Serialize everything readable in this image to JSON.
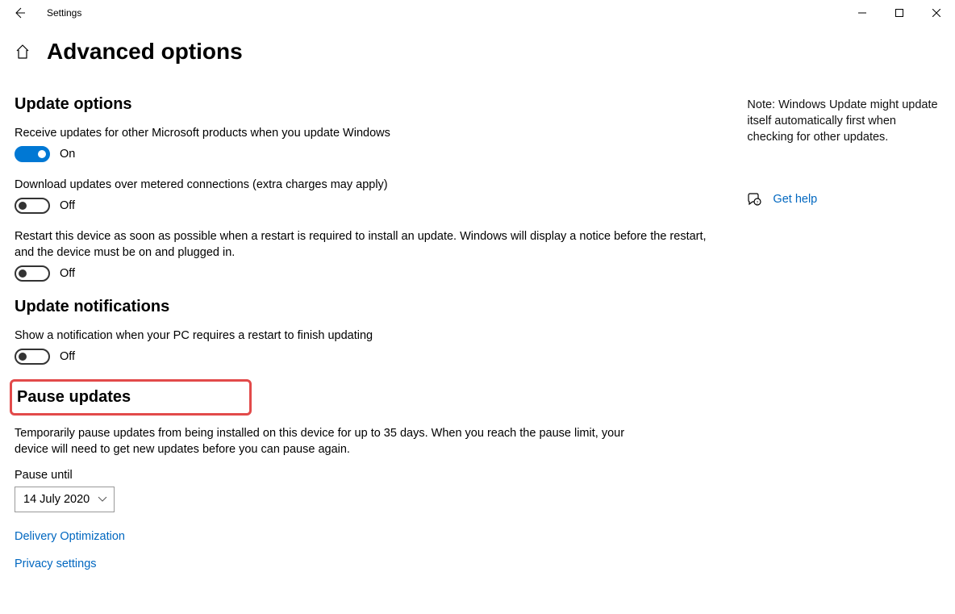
{
  "titlebar": {
    "app_name": "Settings"
  },
  "header": {
    "page_title": "Advanced options"
  },
  "sections": {
    "update_options": {
      "heading": "Update options",
      "opt1_label": "Receive updates for other Microsoft products when you update Windows",
      "opt1_state": "On",
      "opt2_label": "Download updates over metered connections (extra charges may apply)",
      "opt2_state": "Off",
      "opt3_label": "Restart this device as soon as possible when a restart is required to install an update. Windows will display a notice before the restart, and the device must be on and plugged in.",
      "opt3_state": "Off"
    },
    "update_notifications": {
      "heading": "Update notifications",
      "opt1_label": "Show a notification when your PC requires a restart to finish updating",
      "opt1_state": "Off"
    },
    "pause_updates": {
      "heading": "Pause updates",
      "description": "Temporarily pause updates from being installed on this device for up to 35 days. When you reach the pause limit, your device will need to get new updates before you can pause again.",
      "field_label": "Pause until",
      "selected_value": "14 July 2020"
    }
  },
  "links": {
    "delivery": "Delivery Optimization",
    "privacy": "Privacy settings"
  },
  "side": {
    "note": "Note: Windows Update might update itself automatically first when checking for other updates.",
    "help": "Get help"
  }
}
